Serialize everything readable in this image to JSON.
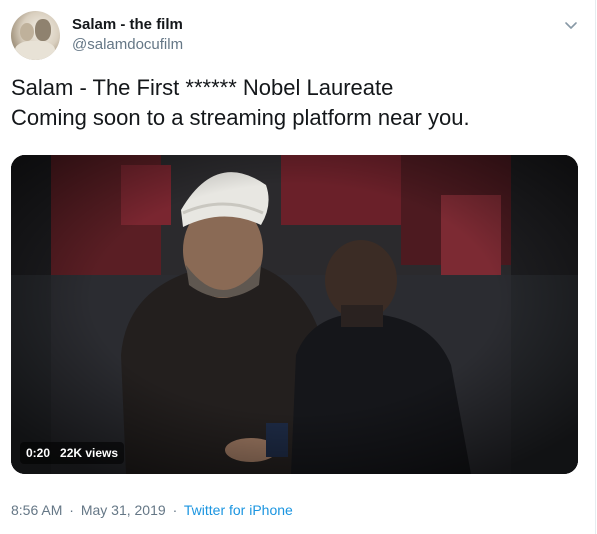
{
  "tweet": {
    "display_name": "Salam - the film",
    "handle": "@salamdocufilm",
    "avatar_icon": "profile-photo",
    "menu_icon": "chevron-down-icon",
    "text_line1": "Salam - The First ****** Nobel Laureate",
    "text_line2": "Coming soon to a streaming platform near you.",
    "video": {
      "duration": "0:20",
      "views": "22K views"
    },
    "time": "8:56 AM",
    "separator": "·",
    "date": "May 31, 2019",
    "source": "Twitter for iPhone"
  },
  "colors": {
    "text": "#14171a",
    "secondary": "#657786",
    "link": "#1b95e0"
  }
}
